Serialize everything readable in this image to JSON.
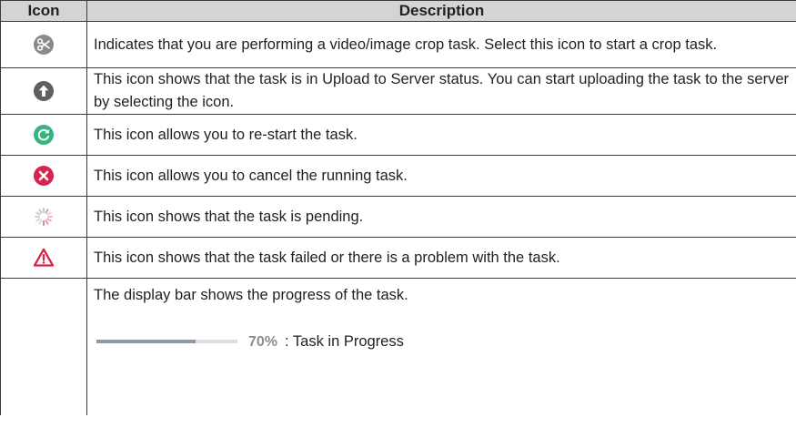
{
  "table": {
    "headers": {
      "icon": "Icon",
      "description": "Description"
    },
    "rows": [
      {
        "icon": "scissors-crop-icon",
        "description": "Indicates that you are performing a video/image crop task. Select this icon to start a crop task."
      },
      {
        "icon": "upload-arrow-icon",
        "description": "This icon shows that the task is in Upload to Server status. You can start uploading the task to the server by selecting the icon."
      },
      {
        "icon": "restart-icon",
        "description": "This icon allows you to re-start the task."
      },
      {
        "icon": "cancel-icon",
        "description": "This icon allows you to cancel the running task."
      },
      {
        "icon": "pending-spinner-icon",
        "description": "This icon shows that the task is pending."
      },
      {
        "icon": "warning-icon",
        "description": "This icon shows that the task failed or there is a problem with the task."
      }
    ],
    "progress_row": {
      "description": "The display bar shows the progress of the task.",
      "progress_percent": 70,
      "percent_label": "70%",
      "status_label": ": Task in Progress"
    }
  },
  "colors": {
    "header_bg": "#d4d4d4",
    "border": "#3c3c3c",
    "gray_icon": "#8a8a8a",
    "dark_icon": "#5f5f5f",
    "green_icon": "#36b37e",
    "red_icon": "#d5254f",
    "warning_icon": "#d5254f",
    "progress_fill": "#8c9aa8",
    "progress_track": "#dddddd"
  }
}
